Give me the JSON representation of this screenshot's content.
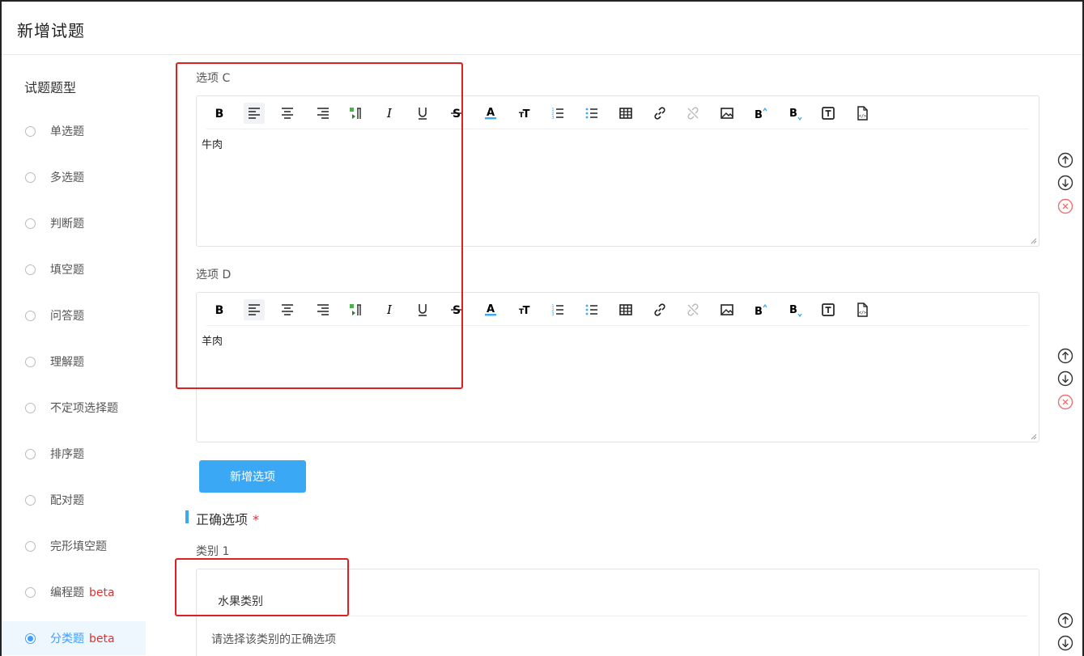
{
  "header": {
    "title": "新增试题"
  },
  "sidebar": {
    "title": "试题题型",
    "items": [
      {
        "label": "单选题",
        "badge": ""
      },
      {
        "label": "多选题",
        "badge": ""
      },
      {
        "label": "判断题",
        "badge": ""
      },
      {
        "label": "填空题",
        "badge": ""
      },
      {
        "label": "问答题",
        "badge": ""
      },
      {
        "label": "理解题",
        "badge": ""
      },
      {
        "label": "不定项选择题",
        "badge": ""
      },
      {
        "label": "排序题",
        "badge": ""
      },
      {
        "label": "配对题",
        "badge": ""
      },
      {
        "label": "完形填空题",
        "badge": ""
      },
      {
        "label": "编程题",
        "badge": "beta"
      },
      {
        "label": "分类题",
        "badge": "beta",
        "selected": true
      }
    ]
  },
  "options": [
    {
      "label": "选项 C",
      "content": "牛肉"
    },
    {
      "label": "选项 D",
      "content": "羊肉"
    }
  ],
  "toolbar": {
    "icons": [
      "bold-icon",
      "align-left-icon",
      "align-center-icon",
      "align-right-icon",
      "paragraph-direction-icon",
      "italic-icon",
      "underline-icon",
      "strikethrough-icon",
      "font-color-icon",
      "font-size-icon",
      "ordered-list-icon",
      "unordered-list-icon",
      "table-icon",
      "link-icon",
      "unlink-icon",
      "image-icon",
      "superscript-icon",
      "subscript-icon",
      "text-box-icon",
      "html-source-icon"
    ],
    "glyphs": [
      "B",
      "≡",
      "≡",
      "≡",
      "¶",
      "I",
      "U",
      "S",
      "A",
      "ᴛT",
      "≔",
      "≔",
      "▦",
      "🔗",
      "⛓",
      "▣",
      "B",
      "B",
      "T",
      "</>"
    ]
  },
  "add_option_label": "新增选项",
  "correct_section": {
    "title": "正确选项",
    "required_mark": "*"
  },
  "category": {
    "label": "类别 1",
    "name": "水果类别",
    "hint": "请选择该类别的正确选项"
  },
  "colors": {
    "accent": "#3aa8f5",
    "danger": "#e03030",
    "annotation": "#e02020"
  }
}
